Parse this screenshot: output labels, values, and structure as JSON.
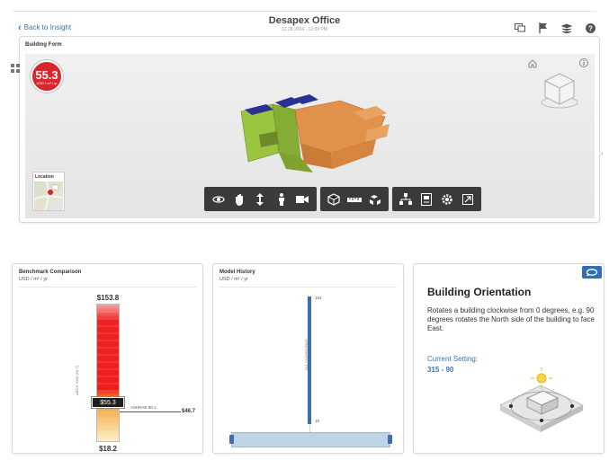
{
  "header": {
    "back_label": "Back to Insight",
    "title": "Desapex Office",
    "subtitle": "12.26.2024 - 12:09 PM",
    "icons": [
      "monitor-icon",
      "flag-icon",
      "layers-icon",
      "help-icon"
    ]
  },
  "building_form": {
    "title": "Building Form",
    "eui_value": "55.3",
    "eui_unit": "USD / m² / yr",
    "location_label": "Location",
    "toolbar_groups": [
      [
        "orbit-icon",
        "pan-icon",
        "zoom-icon",
        "walk-icon",
        "camera-icon"
      ],
      [
        "section-box-icon",
        "measure-icon",
        "explode-icon"
      ],
      [
        "model-tree-icon",
        "properties-icon",
        "settings-icon",
        "fullscreen-icon"
      ]
    ],
    "colors": {
      "eui_badge": "#d9262c",
      "roof": "#e0924a",
      "wall": "#9bc43e",
      "panel": "#2b3190"
    }
  },
  "benchmark": {
    "title": "Benchmark Comparison",
    "unit": "USD / m² / yr",
    "top_value": "$153.8",
    "bottom_value": "$18.2",
    "current_value": "$55.3",
    "axis_label": "ARCH 2030 (93.7)",
    "ashrae_label": "ASHRAE 90.1",
    "ashrae_value": "$46.7"
  },
  "model_history": {
    "title": "Model History",
    "unit": "USD / m² / yr",
    "top_tick": "154",
    "bottom_tick": "18",
    "axis_label": "ALL UNSPECIFIED"
  },
  "orientation": {
    "title": "Building Orientation",
    "description": "Rotates a building clockwise from 0 degrees, e.g. 90 degrees rotates the North side of the building to face East.",
    "current_label": "Current Setting:",
    "current_value": "315 - 90"
  }
}
